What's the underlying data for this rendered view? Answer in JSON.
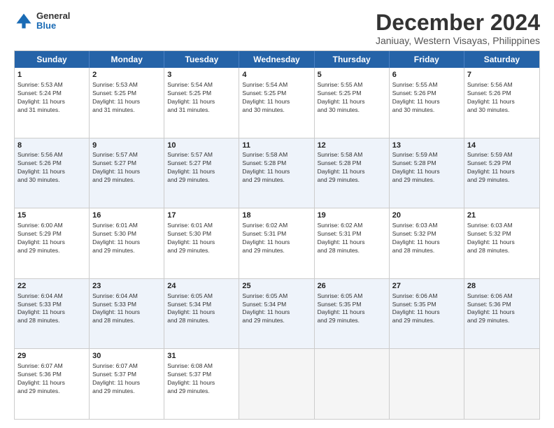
{
  "logo": {
    "line1": "General",
    "line2": "Blue"
  },
  "title": "December 2024",
  "subtitle": "Janiuay, Western Visayas, Philippines",
  "header": {
    "days": [
      "Sunday",
      "Monday",
      "Tuesday",
      "Wednesday",
      "Thursday",
      "Friday",
      "Saturday"
    ]
  },
  "weeks": [
    {
      "alt": false,
      "cells": [
        {
          "day": "1",
          "lines": [
            "Sunrise: 5:53 AM",
            "Sunset: 5:24 PM",
            "Daylight: 11 hours",
            "and 31 minutes."
          ]
        },
        {
          "day": "2",
          "lines": [
            "Sunrise: 5:53 AM",
            "Sunset: 5:25 PM",
            "Daylight: 11 hours",
            "and 31 minutes."
          ]
        },
        {
          "day": "3",
          "lines": [
            "Sunrise: 5:54 AM",
            "Sunset: 5:25 PM",
            "Daylight: 11 hours",
            "and 31 minutes."
          ]
        },
        {
          "day": "4",
          "lines": [
            "Sunrise: 5:54 AM",
            "Sunset: 5:25 PM",
            "Daylight: 11 hours",
            "and 30 minutes."
          ]
        },
        {
          "day": "5",
          "lines": [
            "Sunrise: 5:55 AM",
            "Sunset: 5:25 PM",
            "Daylight: 11 hours",
            "and 30 minutes."
          ]
        },
        {
          "day": "6",
          "lines": [
            "Sunrise: 5:55 AM",
            "Sunset: 5:26 PM",
            "Daylight: 11 hours",
            "and 30 minutes."
          ]
        },
        {
          "day": "7",
          "lines": [
            "Sunrise: 5:56 AM",
            "Sunset: 5:26 PM",
            "Daylight: 11 hours",
            "and 30 minutes."
          ]
        }
      ]
    },
    {
      "alt": true,
      "cells": [
        {
          "day": "8",
          "lines": [
            "Sunrise: 5:56 AM",
            "Sunset: 5:26 PM",
            "Daylight: 11 hours",
            "and 30 minutes."
          ]
        },
        {
          "day": "9",
          "lines": [
            "Sunrise: 5:57 AM",
            "Sunset: 5:27 PM",
            "Daylight: 11 hours",
            "and 29 minutes."
          ]
        },
        {
          "day": "10",
          "lines": [
            "Sunrise: 5:57 AM",
            "Sunset: 5:27 PM",
            "Daylight: 11 hours",
            "and 29 minutes."
          ]
        },
        {
          "day": "11",
          "lines": [
            "Sunrise: 5:58 AM",
            "Sunset: 5:28 PM",
            "Daylight: 11 hours",
            "and 29 minutes."
          ]
        },
        {
          "day": "12",
          "lines": [
            "Sunrise: 5:58 AM",
            "Sunset: 5:28 PM",
            "Daylight: 11 hours",
            "and 29 minutes."
          ]
        },
        {
          "day": "13",
          "lines": [
            "Sunrise: 5:59 AM",
            "Sunset: 5:28 PM",
            "Daylight: 11 hours",
            "and 29 minutes."
          ]
        },
        {
          "day": "14",
          "lines": [
            "Sunrise: 5:59 AM",
            "Sunset: 5:29 PM",
            "Daylight: 11 hours",
            "and 29 minutes."
          ]
        }
      ]
    },
    {
      "alt": false,
      "cells": [
        {
          "day": "15",
          "lines": [
            "Sunrise: 6:00 AM",
            "Sunset: 5:29 PM",
            "Daylight: 11 hours",
            "and 29 minutes."
          ]
        },
        {
          "day": "16",
          "lines": [
            "Sunrise: 6:01 AM",
            "Sunset: 5:30 PM",
            "Daylight: 11 hours",
            "and 29 minutes."
          ]
        },
        {
          "day": "17",
          "lines": [
            "Sunrise: 6:01 AM",
            "Sunset: 5:30 PM",
            "Daylight: 11 hours",
            "and 29 minutes."
          ]
        },
        {
          "day": "18",
          "lines": [
            "Sunrise: 6:02 AM",
            "Sunset: 5:31 PM",
            "Daylight: 11 hours",
            "and 29 minutes."
          ]
        },
        {
          "day": "19",
          "lines": [
            "Sunrise: 6:02 AM",
            "Sunset: 5:31 PM",
            "Daylight: 11 hours",
            "and 28 minutes."
          ]
        },
        {
          "day": "20",
          "lines": [
            "Sunrise: 6:03 AM",
            "Sunset: 5:32 PM",
            "Daylight: 11 hours",
            "and 28 minutes."
          ]
        },
        {
          "day": "21",
          "lines": [
            "Sunrise: 6:03 AM",
            "Sunset: 5:32 PM",
            "Daylight: 11 hours",
            "and 28 minutes."
          ]
        }
      ]
    },
    {
      "alt": true,
      "cells": [
        {
          "day": "22",
          "lines": [
            "Sunrise: 6:04 AM",
            "Sunset: 5:33 PM",
            "Daylight: 11 hours",
            "and 28 minutes."
          ]
        },
        {
          "day": "23",
          "lines": [
            "Sunrise: 6:04 AM",
            "Sunset: 5:33 PM",
            "Daylight: 11 hours",
            "and 28 minutes."
          ]
        },
        {
          "day": "24",
          "lines": [
            "Sunrise: 6:05 AM",
            "Sunset: 5:34 PM",
            "Daylight: 11 hours",
            "and 28 minutes."
          ]
        },
        {
          "day": "25",
          "lines": [
            "Sunrise: 6:05 AM",
            "Sunset: 5:34 PM",
            "Daylight: 11 hours",
            "and 29 minutes."
          ]
        },
        {
          "day": "26",
          "lines": [
            "Sunrise: 6:05 AM",
            "Sunset: 5:35 PM",
            "Daylight: 11 hours",
            "and 29 minutes."
          ]
        },
        {
          "day": "27",
          "lines": [
            "Sunrise: 6:06 AM",
            "Sunset: 5:35 PM",
            "Daylight: 11 hours",
            "and 29 minutes."
          ]
        },
        {
          "day": "28",
          "lines": [
            "Sunrise: 6:06 AM",
            "Sunset: 5:36 PM",
            "Daylight: 11 hours",
            "and 29 minutes."
          ]
        }
      ]
    },
    {
      "alt": false,
      "cells": [
        {
          "day": "29",
          "lines": [
            "Sunrise: 6:07 AM",
            "Sunset: 5:36 PM",
            "Daylight: 11 hours",
            "and 29 minutes."
          ]
        },
        {
          "day": "30",
          "lines": [
            "Sunrise: 6:07 AM",
            "Sunset: 5:37 PM",
            "Daylight: 11 hours",
            "and 29 minutes."
          ]
        },
        {
          "day": "31",
          "lines": [
            "Sunrise: 6:08 AM",
            "Sunset: 5:37 PM",
            "Daylight: 11 hours",
            "and 29 minutes."
          ]
        },
        {
          "day": "",
          "lines": []
        },
        {
          "day": "",
          "lines": []
        },
        {
          "day": "",
          "lines": []
        },
        {
          "day": "",
          "lines": []
        }
      ]
    }
  ]
}
